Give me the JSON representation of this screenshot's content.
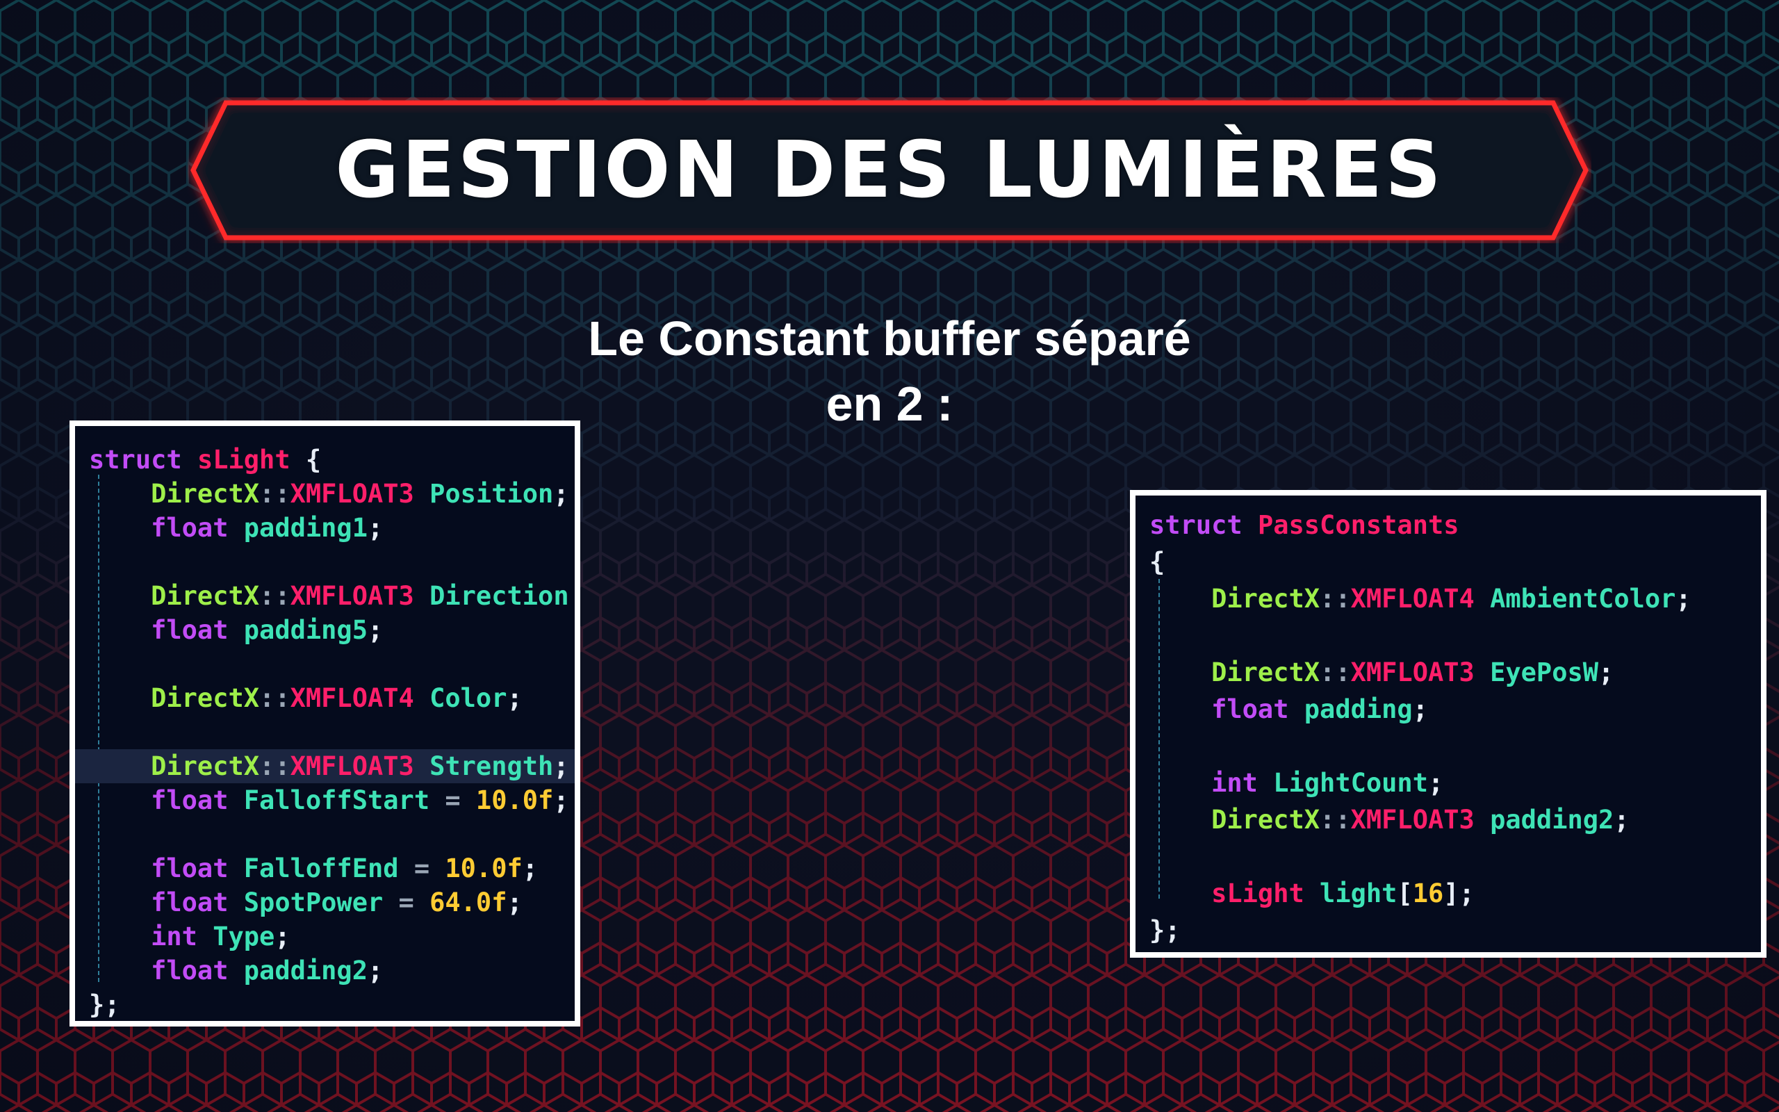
{
  "slide": {
    "title": "GESTION DES LUMIÈRES",
    "subtitle_lines": [
      "Le Constant buffer séparé",
      "en 2 :"
    ]
  },
  "code_left": {
    "lines": [
      [
        [
          "kw",
          "struct"
        ],
        [
          "pl",
          " "
        ],
        [
          "type",
          "sLight"
        ],
        [
          "pl",
          " "
        ],
        [
          "punc",
          "{"
        ]
      ],
      [
        [
          "pl",
          "    "
        ],
        [
          "ns",
          "DirectX"
        ],
        [
          "op",
          "::"
        ],
        [
          "type",
          "XMFLOAT3"
        ],
        [
          "pl",
          " "
        ],
        [
          "id",
          "Position"
        ],
        [
          "punc",
          ";"
        ]
      ],
      [
        [
          "pl",
          "    "
        ],
        [
          "kw",
          "float"
        ],
        [
          "pl",
          " "
        ],
        [
          "id",
          "padding1"
        ],
        [
          "punc",
          ";"
        ]
      ],
      [],
      [
        [
          "pl",
          "    "
        ],
        [
          "ns",
          "DirectX"
        ],
        [
          "op",
          "::"
        ],
        [
          "type",
          "XMFLOAT3"
        ],
        [
          "pl",
          " "
        ],
        [
          "id",
          "Direction"
        ]
      ],
      [
        [
          "pl",
          "    "
        ],
        [
          "kw",
          "float"
        ],
        [
          "pl",
          " "
        ],
        [
          "id",
          "padding5"
        ],
        [
          "punc",
          ";"
        ]
      ],
      [],
      [
        [
          "pl",
          "    "
        ],
        [
          "ns",
          "DirectX"
        ],
        [
          "op",
          "::"
        ],
        [
          "type",
          "XMFLOAT4"
        ],
        [
          "pl",
          " "
        ],
        [
          "id",
          "Color"
        ],
        [
          "punc",
          ";"
        ]
      ],
      [],
      [
        [
          "pl",
          "    "
        ],
        [
          "ns",
          "DirectX"
        ],
        [
          "op",
          "::"
        ],
        [
          "type",
          "XMFLOAT3"
        ],
        [
          "pl",
          " "
        ],
        [
          "id",
          "Strength"
        ],
        [
          "punc",
          ";"
        ]
      ],
      [
        [
          "pl",
          "    "
        ],
        [
          "kw",
          "float"
        ],
        [
          "pl",
          " "
        ],
        [
          "id",
          "FalloffStart"
        ],
        [
          "op",
          " = "
        ],
        [
          "num",
          "10.0f"
        ],
        [
          "punc",
          ";"
        ]
      ],
      [],
      [
        [
          "pl",
          "    "
        ],
        [
          "kw",
          "float"
        ],
        [
          "pl",
          " "
        ],
        [
          "id",
          "FalloffEnd"
        ],
        [
          "op",
          " = "
        ],
        [
          "num",
          "10.0f"
        ],
        [
          "punc",
          ";"
        ]
      ],
      [
        [
          "pl",
          "    "
        ],
        [
          "kw",
          "float"
        ],
        [
          "pl",
          " "
        ],
        [
          "id",
          "SpotPower"
        ],
        [
          "op",
          " = "
        ],
        [
          "num",
          "64.0f"
        ],
        [
          "punc",
          ";"
        ]
      ],
      [
        [
          "pl",
          "    "
        ],
        [
          "kw",
          "int"
        ],
        [
          "pl",
          " "
        ],
        [
          "id",
          "Type"
        ],
        [
          "punc",
          ";"
        ]
      ],
      [
        [
          "pl",
          "    "
        ],
        [
          "kw",
          "float"
        ],
        [
          "pl",
          " "
        ],
        [
          "id",
          "padding2"
        ],
        [
          "punc",
          ";"
        ]
      ],
      [
        [
          "punc",
          "};"
        ]
      ]
    ],
    "highlighted_line": 9
  },
  "code_right": {
    "lines": [
      [
        [
          "kw",
          "struct"
        ],
        [
          "pl",
          " "
        ],
        [
          "type",
          "PassConstants"
        ]
      ],
      [
        [
          "punc",
          "{"
        ]
      ],
      [
        [
          "pl",
          "    "
        ],
        [
          "ns",
          "DirectX"
        ],
        [
          "op",
          "::"
        ],
        [
          "type",
          "XMFLOAT4"
        ],
        [
          "pl",
          " "
        ],
        [
          "id",
          "AmbientColor"
        ],
        [
          "punc",
          ";"
        ]
      ],
      [],
      [
        [
          "pl",
          "    "
        ],
        [
          "ns",
          "DirectX"
        ],
        [
          "op",
          "::"
        ],
        [
          "type",
          "XMFLOAT3"
        ],
        [
          "pl",
          " "
        ],
        [
          "id",
          "EyePosW"
        ],
        [
          "punc",
          ";"
        ]
      ],
      [
        [
          "pl",
          "    "
        ],
        [
          "kw",
          "float"
        ],
        [
          "pl",
          " "
        ],
        [
          "id",
          "padding"
        ],
        [
          "punc",
          ";"
        ]
      ],
      [],
      [
        [
          "pl",
          "    "
        ],
        [
          "kw",
          "int"
        ],
        [
          "pl",
          " "
        ],
        [
          "id",
          "LightCount"
        ],
        [
          "punc",
          ";"
        ]
      ],
      [
        [
          "pl",
          "    "
        ],
        [
          "ns",
          "DirectX"
        ],
        [
          "op",
          "::"
        ],
        [
          "type",
          "XMFLOAT3"
        ],
        [
          "pl",
          " "
        ],
        [
          "id",
          "padding2"
        ],
        [
          "punc",
          ";"
        ]
      ],
      [],
      [
        [
          "pl",
          "    "
        ],
        [
          "type",
          "sLight"
        ],
        [
          "pl",
          " "
        ],
        [
          "id",
          "light"
        ],
        [
          "punc",
          "["
        ],
        [
          "num",
          "16"
        ],
        [
          "punc",
          "];"
        ]
      ],
      [
        [
          "punc",
          "};"
        ]
      ]
    ]
  },
  "syntax_colors": {
    "kw": "#c24cf6",
    "type": "#ff1f6a",
    "ns": "#9eef4a",
    "id": "#3ee3b6",
    "num": "#ffcc33",
    "punc": "#e8eef7",
    "op": "#9aa6b5"
  },
  "theme": {
    "banner_border": "#ff2a2a",
    "banner_fill": "#0b1224",
    "hex_top": "#1e8c93",
    "hex_bottom": "#e01a2a",
    "background": "#0c1020"
  }
}
